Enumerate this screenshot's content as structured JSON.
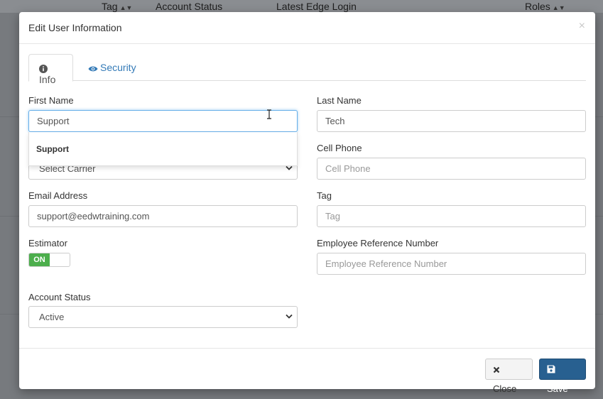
{
  "background": {
    "columns": [
      {
        "label": "Tag",
        "sortable": true
      },
      {
        "label": "Account Status",
        "sortable": false
      },
      {
        "label": "Latest Edge Login",
        "sortable": false
      },
      {
        "label": "Roles",
        "sortable": true
      }
    ]
  },
  "modal": {
    "title": "Edit User Information",
    "close_symbol": "×",
    "tabs": [
      {
        "label": "Info",
        "icon": "info-circle-icon",
        "active": true
      },
      {
        "label": "Security",
        "icon": "eye-icon",
        "active": false
      }
    ],
    "fields": {
      "first_name": {
        "label": "First Name",
        "value": "Support",
        "placeholder": "First Name"
      },
      "last_name": {
        "label": "Last Name",
        "value": "Tech",
        "placeholder": "Last Name"
      },
      "carrier": {
        "value": "Select Carrier"
      },
      "cell_phone": {
        "label": "Cell Phone",
        "value": "",
        "placeholder": "Cell Phone"
      },
      "email": {
        "label": "Email Address",
        "value": "support@eedwtraining.com"
      },
      "tag": {
        "label": "Tag",
        "value": "",
        "placeholder": "Tag"
      },
      "estimator": {
        "label": "Estimator",
        "toggle_label": "ON"
      },
      "employee_ref": {
        "label": "Employee Reference Number",
        "value": "",
        "placeholder": "Employee Reference Number"
      },
      "account_status": {
        "label": "Account Status",
        "value": "Active"
      }
    },
    "autocomplete": {
      "suggestion": "Support"
    },
    "footer": {
      "close_label": "Close",
      "save_label": "Save"
    }
  },
  "colors": {
    "primary": "#286090",
    "link": "#337ab7",
    "toggle_on": "#4cae4c",
    "focus": "#66afe9"
  }
}
